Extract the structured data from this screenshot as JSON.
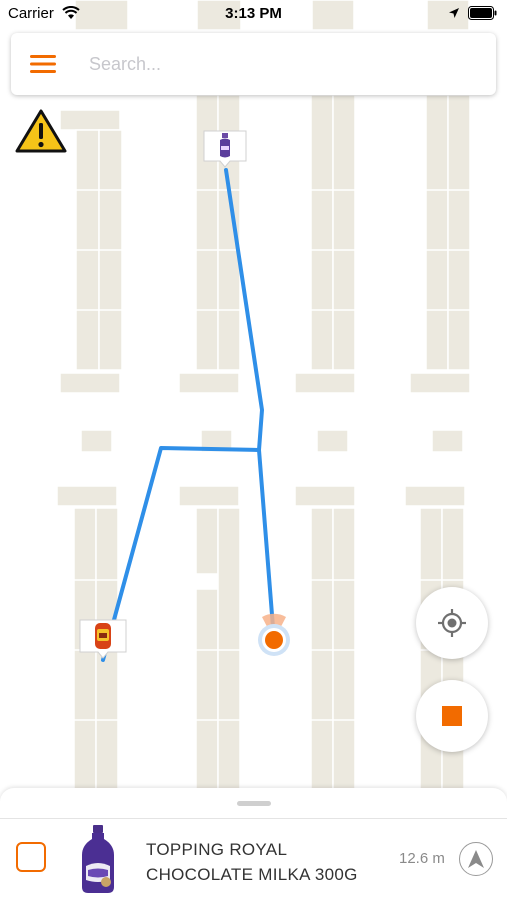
{
  "status_bar": {
    "carrier": "Carrier",
    "time": "3:13 PM"
  },
  "search": {
    "placeholder": "Search..."
  },
  "route": {
    "color": "#2f8fe8"
  },
  "accent_color": "#f26b00",
  "current_item": {
    "name_line1": "TOPPING ROYAL",
    "name_line2": "CHOCOLATE MILKA 300G",
    "distance": "12.6 m"
  },
  "icons": {
    "menu": "hamburger-menu-icon",
    "warning": "warning-triangle-icon",
    "locate": "crosshair-locate-icon",
    "stop": "stop-square-icon",
    "navigate": "navigation-arrow-icon"
  }
}
